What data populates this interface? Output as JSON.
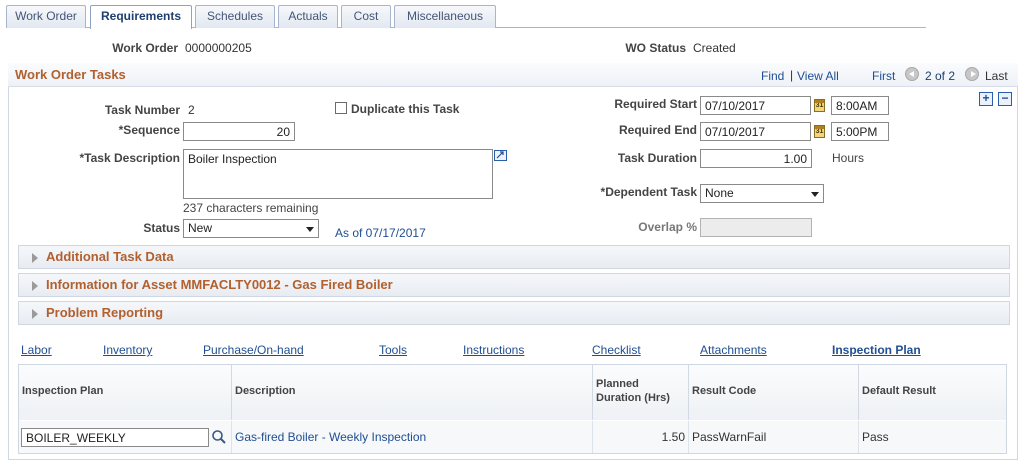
{
  "tabs": [
    {
      "label": "Work Order",
      "active": false
    },
    {
      "label": "Requirements",
      "active": true
    },
    {
      "label": "Schedules",
      "active": false
    },
    {
      "label": "Actuals",
      "active": false
    },
    {
      "label": "Cost",
      "active": false
    },
    {
      "label": "Miscellaneous",
      "active": false
    }
  ],
  "header": {
    "work_order_label": "Work Order",
    "work_order_value": "0000000205",
    "wo_status_label": "WO Status",
    "wo_status_value": "Created"
  },
  "tasks": {
    "title": "Work Order Tasks",
    "find": "Find",
    "separator": "|",
    "view_all": "View All",
    "first": "First",
    "pager": "2 of 2",
    "last": "Last",
    "add": "+",
    "remove": "−",
    "task_number_label": "Task Number",
    "task_number_value": "2",
    "duplicate_label": "Duplicate this Task",
    "sequence_label": "*Sequence",
    "sequence_value": "20",
    "description_label": "*Task Description",
    "description_value": "Boiler Inspection",
    "chars_remaining": "237 characters remaining",
    "status_label": "Status",
    "status_value": "New",
    "as_of": "As of 07/17/2017",
    "required_start_label": "Required Start",
    "required_start_date": "07/10/2017",
    "required_start_time": "8:00AM",
    "required_end_label": "Required End",
    "required_end_date": "07/10/2017",
    "required_end_time": "5:00PM",
    "duration_label": "Task Duration",
    "duration_value": "1.00",
    "duration_unit": "Hours",
    "dependent_label": "*Dependent Task",
    "dependent_value": "None",
    "overlap_label": "Overlap %",
    "overlap_value": "",
    "calendar_glyph": "31"
  },
  "sections": [
    "Additional Task Data",
    "Information for Asset MMFACLTY0012 - Gas Fired Boiler",
    "Problem Reporting"
  ],
  "links": [
    "Labor",
    "Inventory",
    "Purchase/On-hand",
    "Tools",
    "Instructions",
    "Checklist",
    "Attachments",
    "Inspection Plan"
  ],
  "grid": {
    "headers": {
      "plan": "Inspection Plan",
      "description": "Description",
      "duration_line1": "Planned",
      "duration_line2": "Duration (Hrs)",
      "result_code": "Result Code",
      "default_result": "Default Result"
    },
    "rows": [
      {
        "plan": "BOILER_WEEKLY",
        "description": "Gas-fired Boiler - Weekly Inspection",
        "duration": "1.50",
        "result_code": "PassWarnFail",
        "default_result": "Pass"
      }
    ]
  },
  "colors": {
    "accent_orange": "#b2602d",
    "link_blue": "#1f4e92"
  }
}
